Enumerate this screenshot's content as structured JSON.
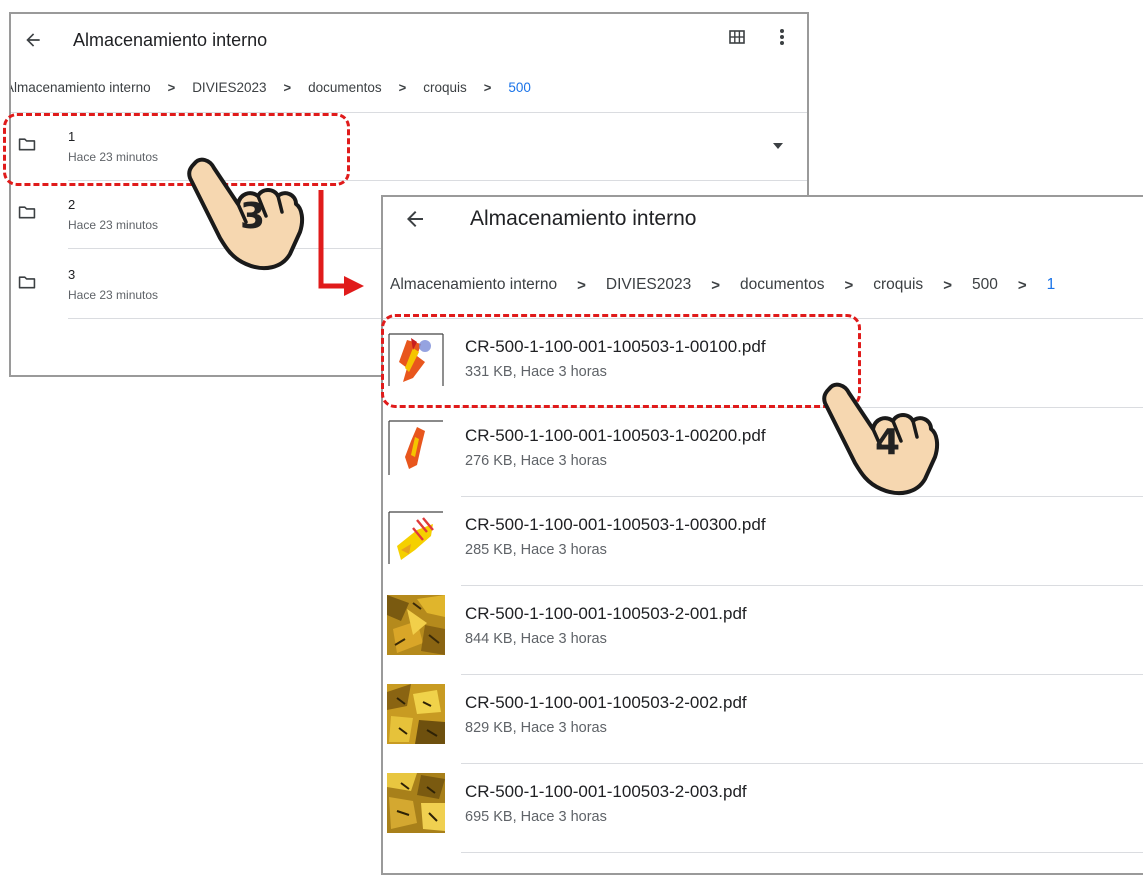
{
  "window_back": {
    "title": "Almacenamiento interno",
    "breadcrumb": [
      "Almacenamiento interno",
      "DIVIES2023",
      "documentos",
      "croquis",
      "500"
    ],
    "folders": [
      {
        "name": "1",
        "subtitle": "Hace 23 minutos"
      },
      {
        "name": "2",
        "subtitle": "Hace 23 minutos"
      },
      {
        "name": "3",
        "subtitle": "Hace 23 minutos"
      }
    ],
    "icons": {
      "back": "arrow-left-icon",
      "grid": "grid-view-icon",
      "menu": "more-vertical-icon",
      "dropdown": "dropdown-arrow-icon",
      "folder": "folder-icon"
    }
  },
  "window_front": {
    "title": "Almacenamiento interno",
    "breadcrumb": [
      "Almacenamiento interno",
      "DIVIES2023",
      "documentos",
      "croquis",
      "500",
      "1"
    ],
    "files": [
      {
        "name": "CR-500-1-100-001-100503-1-00100.pdf",
        "meta": "331 KB, Hace 3 horas"
      },
      {
        "name": "CR-500-1-100-001-100503-1-00200.pdf",
        "meta": "276 KB, Hace 3 horas"
      },
      {
        "name": "CR-500-1-100-001-100503-1-00300.pdf",
        "meta": "285 KB, Hace 3 horas"
      },
      {
        "name": "CR-500-1-100-001-100503-2-001.pdf",
        "meta": "844 KB, Hace 3 horas"
      },
      {
        "name": "CR-500-1-100-001-100503-2-002.pdf",
        "meta": "829 KB, Hace 3 horas"
      },
      {
        "name": "CR-500-1-100-001-100503-2-003.pdf",
        "meta": "695 KB, Hace 3 horas"
      }
    ]
  },
  "annotations": {
    "step3": "3",
    "step4": "4"
  },
  "colors": {
    "highlight": "#e01b1b",
    "active_crumb": "#1a73e8",
    "hand_fill": "#f6d7b0"
  }
}
